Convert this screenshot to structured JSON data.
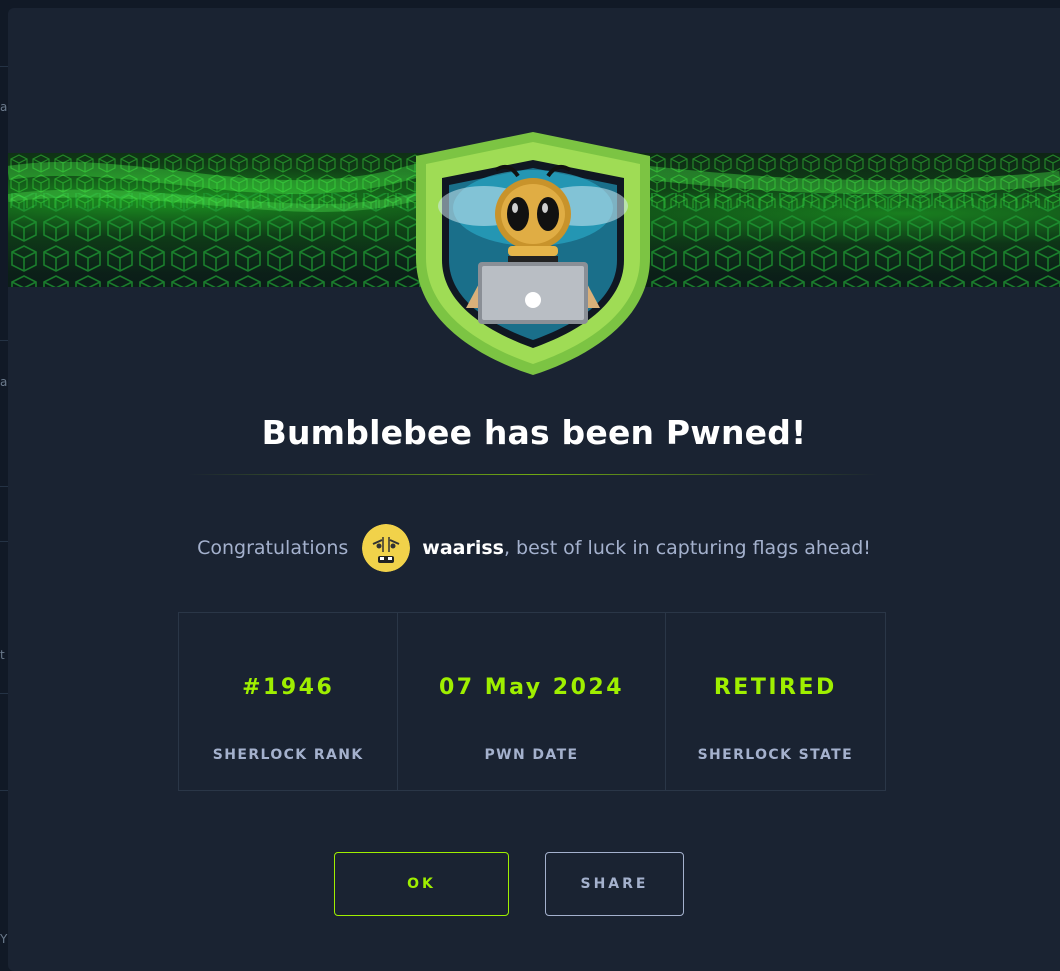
{
  "modal": {
    "title": "Bumblebee has been Pwned!",
    "congrats_prefix": "Congratulations",
    "username": "waariss",
    "congrats_suffix": ", best of luck in capturing flags ahead!"
  },
  "stats": [
    {
      "value": "#1946",
      "label": "SHERLOCK RANK"
    },
    {
      "value": "07 May 2024",
      "label": "PWN DATE"
    },
    {
      "value": "RETIRED",
      "label": "SHERLOCK STATE"
    }
  ],
  "buttons": {
    "ok_label": "OK",
    "share_label": "SHARE"
  },
  "background_fragments": [
    "a",
    "a",
    "t",
    "Y"
  ],
  "colors": {
    "accent": "#9fef00",
    "modal_bg": "#1a2332",
    "muted_text": "#a4b1cd",
    "badge_green": "#8bc34a"
  },
  "icons": {
    "badge": "bumblebee-laptop-badge",
    "avatar": "user-avatar"
  }
}
